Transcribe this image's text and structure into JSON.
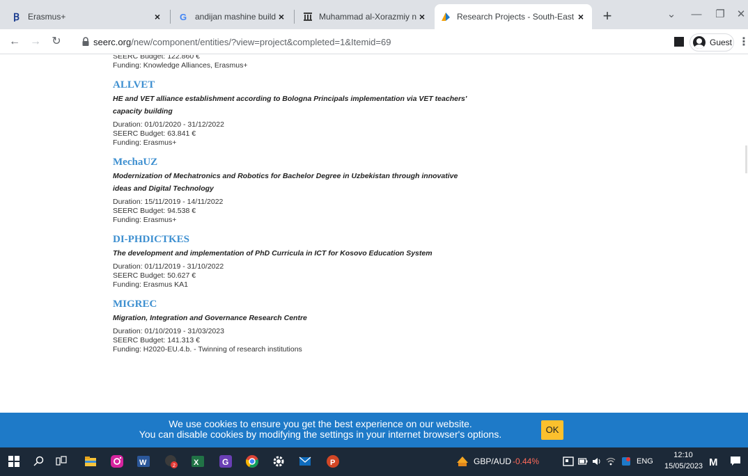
{
  "browser": {
    "tabs": [
      {
        "title": "Erasmus+",
        "favicon": "erasmus-icon"
      },
      {
        "title": "andijan mashine building - Goog",
        "favicon": "google-icon"
      },
      {
        "title": "Muhammad al-Xorazmiy nomida",
        "favicon": "university-icon"
      },
      {
        "title": "Research Projects - South-East E",
        "favicon": "seerc-icon",
        "active": true
      }
    ],
    "url_host": "seerc.org",
    "url_path": "/new/component/entities/?view=project&completed=1&Itemid=69",
    "profile_label": "Guest"
  },
  "page": {
    "top_partial": {
      "budget": "SEERC Budget: 122.860 €",
      "funding": "Funding: Knowledge Alliances, Erasmus+"
    },
    "projects": [
      {
        "title": "ALLVET",
        "desc_line1": "HE and VET alliance establishment according to Bologna Principals implementation via VET teachers'",
        "desc_line2": "capacity building",
        "duration": "Duration: 01/01/2020 - 31/12/2022",
        "budget": "SEERC Budget: 63.841 €",
        "funding": "Funding: Erasmus+"
      },
      {
        "title": "MechaUZ",
        "desc_line1": "Modernization of Mechatronics and Robotics for Bachelor Degree in Uzbekistan through innovative",
        "desc_line2": "ideas and Digital Technology",
        "duration": "Duration: 15/11/2019 - 14/11/2022",
        "budget": "SEERC Budget: 94.538 €",
        "funding": "Funding: Erasmus+"
      },
      {
        "title": "DI-PHDICTKES",
        "desc_line1": "The development and implementation of PhD Curricula in ICT for Kosovo Education System",
        "desc_line2": "",
        "duration": "Duration: 01/11/2019 - 31/10/2022",
        "budget": "SEERC Budget: 50.627 €",
        "funding": "Funding: Erasmus KA1"
      },
      {
        "title": "MIGREC",
        "desc_line1": "Migration, Integration and Governance Research Centre",
        "desc_line2": "",
        "duration": "Duration: 01/10/2019 - 31/03/2023",
        "budget": "SEERC Budget: 141.313 €",
        "funding": "Funding: H2020-EU.4.b. - Twinning of research institutions"
      }
    ]
  },
  "cookie": {
    "line1": "We use cookies to ensure you get the best experience on our website.",
    "line2": "You can disable cookies by modifying the settings in your internet browser's options.",
    "ok_label": "OK"
  },
  "taskbar": {
    "ticker_label": "GBP/AUD",
    "ticker_value": "-0.44%",
    "ticker_color": "#ff6b5a",
    "lang": "ENG",
    "time": "12:10",
    "date": "15/05/2023"
  },
  "colors": {
    "project_title": "#3d8fd0",
    "cookie_bar": "#1e7ac8",
    "cookie_ok": "#fbc02d",
    "taskbar": "#1c2938"
  }
}
